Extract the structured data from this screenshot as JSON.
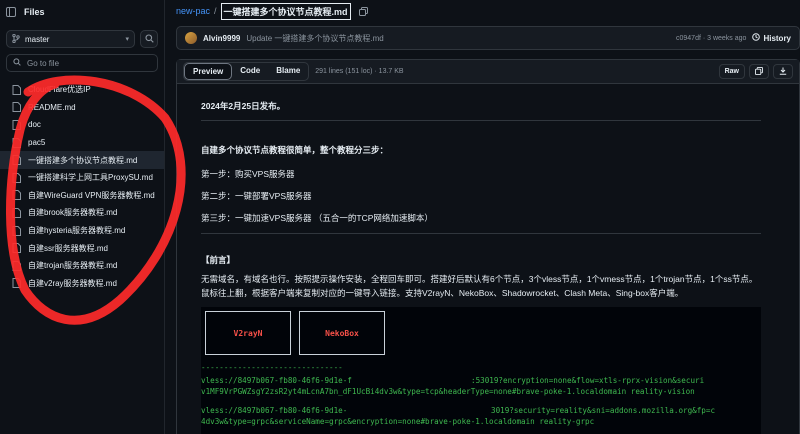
{
  "sidebar": {
    "title": "Files",
    "branch": "master",
    "goto_placeholder": "Go to file",
    "files": [
      {
        "label": "CloudFlare优选IP",
        "active": false
      },
      {
        "label": "README.md",
        "active": false
      },
      {
        "label": "doc",
        "active": false
      },
      {
        "label": "pac5",
        "active": false
      },
      {
        "label": "一键搭建多个协议节点教程.md",
        "active": true
      },
      {
        "label": "一键搭建科学上网工具ProxySU.md",
        "active": false
      },
      {
        "label": "自建WireGuard VPN服务器教程.md",
        "active": false
      },
      {
        "label": "自建brook服务器教程.md",
        "active": false
      },
      {
        "label": "自建hysteria服务器教程.md",
        "active": false
      },
      {
        "label": "自建ssr服务器教程.md",
        "active": false
      },
      {
        "label": "自建trojan服务器教程.md",
        "active": false
      },
      {
        "label": "自建v2ray服务器教程.md",
        "active": false
      }
    ]
  },
  "breadcrumb": {
    "repo": "new-pac",
    "sep": "/",
    "file": "一键搭建多个协议节点教程.md"
  },
  "commit": {
    "author": "Alvin9999",
    "message": "Update 一键搭建多个协议节点教程.md",
    "meta": "c0947df · 3 weeks ago",
    "history": "History"
  },
  "viewer": {
    "tabs": [
      "Preview",
      "Code",
      "Blame"
    ],
    "meta": "291 lines (151 loc) · 13.7 KB",
    "raw": "Raw"
  },
  "doc": {
    "date": "2024年2月25日发布。",
    "intro": "自建多个协议节点教程很简单，整个教程分三步：",
    "step1": "第一步：购买VPS服务器",
    "step2": "第二步：一键部署VPS服务器",
    "step3": "第三步：一键加速VPS服务器 （五合一的TCP网络加速脚本）",
    "preface_title": "【前言】",
    "preface_text": "无需域名，有域名也行。按照提示操作安装，全程回车即可。搭建好后默认有6个节点，3个vless节点，1个vmess节点，1个trojan节点，1个ss节点。鼠标往上翻，根据客户端来复制对应的一键导入链接。支持V2rayN、NekoBox、Shadowrocket、Clash Meta、Sing-box客户端。",
    "code_buttons": [
      "V2rayN",
      "NekoBox"
    ],
    "code_lines": [
      "-------------------------------",
      "vless://8497b067-fb80-46f6-9d1e-f",
      ":53019?encryption=none&flow=xtls-rprx-vision&securi",
      "v1MF9VrPGWZsgY2zsR2yt4mLcnA7bn_dF1UcBi4dv3w&type=tcp&headerType=none#brave-poke-1.localdomain reality-vision",
      "vless://8497b067-fb80-46f6-9d1e-",
      "3019?security=reality&sni=addons.mozilla.org&fp=c",
      "4dv3w&type=grpc&serviceName=grpc&encryption=none#brave-poke-1.localdomain reality-grpc"
    ]
  }
}
